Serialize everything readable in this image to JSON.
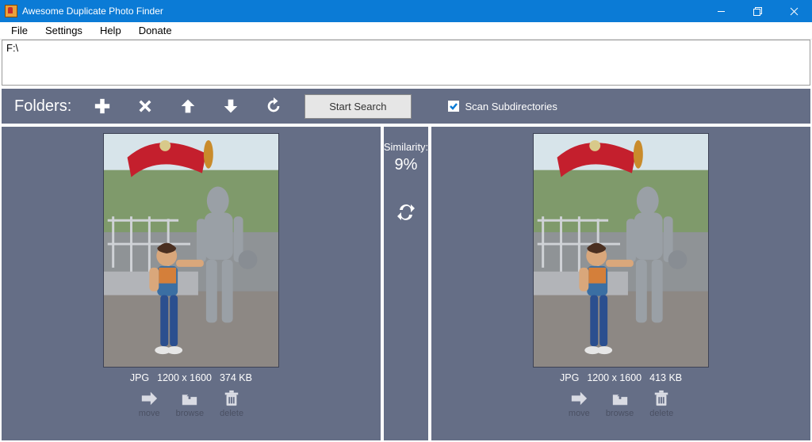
{
  "window": {
    "title": "Awesome Duplicate Photo Finder"
  },
  "menu": {
    "file": "File",
    "settings": "Settings",
    "help": "Help",
    "donate": "Donate"
  },
  "path": "F:\\",
  "toolbar": {
    "folders_label": "Folders:",
    "start_search": "Start Search",
    "scan_subdirs": "Scan Subdirectories"
  },
  "left": {
    "format": "JPG",
    "dimensions": "1200 x 1600",
    "size": "374 KB",
    "actions": {
      "move": "move",
      "browse": "browse",
      "delete": "delete"
    }
  },
  "right": {
    "format": "JPG",
    "dimensions": "1200 x 1600",
    "size": "413 KB",
    "actions": {
      "move": "move",
      "browse": "browse",
      "delete": "delete"
    }
  },
  "similarity": {
    "label": "Similarity:",
    "value": "9%"
  }
}
